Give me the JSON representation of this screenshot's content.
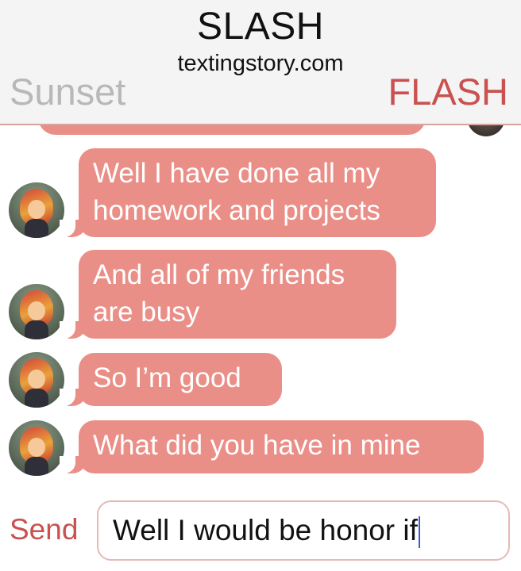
{
  "header": {
    "title": "SLASH",
    "subtitle": "textingstory.com",
    "left_name": "Sunset",
    "right_name": "FLASH"
  },
  "messages": [
    {
      "sender": "Sunset",
      "text": "Well I have done all my\nhomework and projects"
    },
    {
      "sender": "Sunset",
      "text": "And all of my friends\nare busy"
    },
    {
      "sender": "Sunset",
      "text": "So I’m good"
    },
    {
      "sender": "Sunset",
      "text": "What did you have in mine"
    }
  ],
  "composer": {
    "send_label": "Send",
    "input_value": "Well I would be honor if"
  },
  "colors": {
    "bubble": "#ea8f88",
    "accent": "#c9514f",
    "sunset_name": "#b8b8b8"
  },
  "icons": {
    "avatar": "sunset-avatar-icon"
  }
}
